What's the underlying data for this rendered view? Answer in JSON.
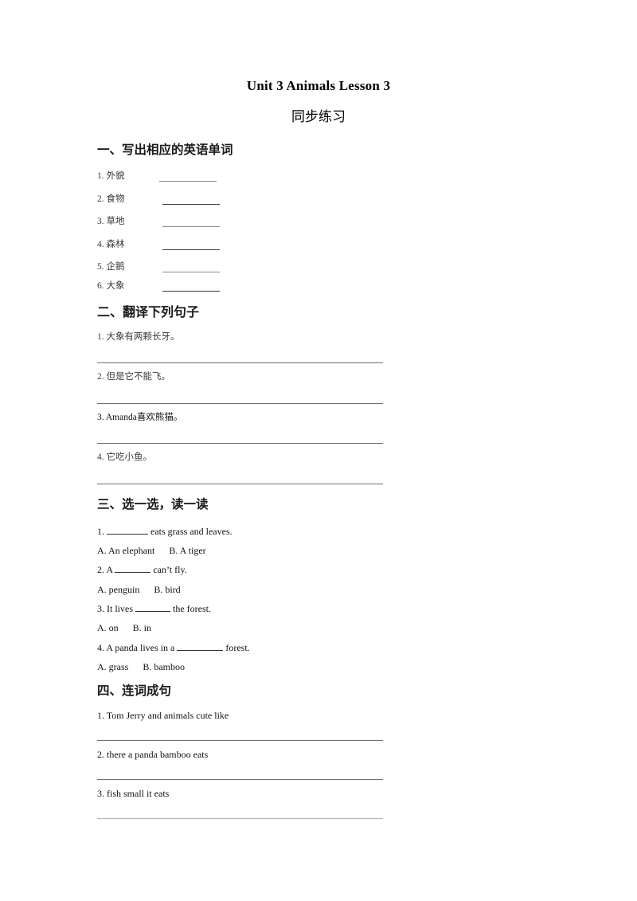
{
  "document": {
    "title": "Unit 3 Animals Lesson 3",
    "subtitle": "同步练习"
  },
  "sections": [
    {
      "heading": "一、写出相应的英语单词",
      "items": [
        {
          "number": "1.",
          "text": "外貌"
        },
        {
          "number": "2.",
          "text": "食物"
        },
        {
          "number": "3.",
          "text": "草地"
        },
        {
          "number": "4.",
          "text": "森林"
        },
        {
          "number": "5.",
          "text": "企鹅"
        },
        {
          "number": "6.",
          "text": "大象"
        }
      ]
    },
    {
      "heading": "二、翻译下列句子",
      "items": [
        {
          "number": "1.",
          "text": "大象有两颗长牙。"
        },
        {
          "number": "2.",
          "text": "但是它不能飞。"
        },
        {
          "number": "3.",
          "text": "Amanda喜欢熊猫。"
        },
        {
          "number": "4.",
          "text": "它吃小鱼。"
        }
      ]
    },
    {
      "heading": "三、选一选，读一读",
      "questions": [
        {
          "number": "1.",
          "before": "",
          "after": "eats grass and leaves.",
          "option_a": "A. An elephant",
          "option_b": "B. A tiger"
        },
        {
          "number": "2.",
          "before": "A",
          "after": "can’t fly.",
          "option_a": "A. penguin",
          "option_b": "B. bird"
        },
        {
          "number": "3.",
          "before": "It lives",
          "after": "the forest.",
          "option_a": "A. on",
          "option_b": "B. in"
        },
        {
          "number": "4.",
          "before": "A panda lives in a",
          "after": "forest.",
          "option_a": "A. grass",
          "option_b": "B. bamboo"
        }
      ]
    },
    {
      "heading": "四、连词成句",
      "items": [
        {
          "number": "1.",
          "text": "Tom Jerry and animals cute like"
        },
        {
          "number": "2.",
          "text": "there a panda bamboo eats"
        },
        {
          "number": "3.",
          "text": "fish small it eats"
        }
      ]
    }
  ]
}
